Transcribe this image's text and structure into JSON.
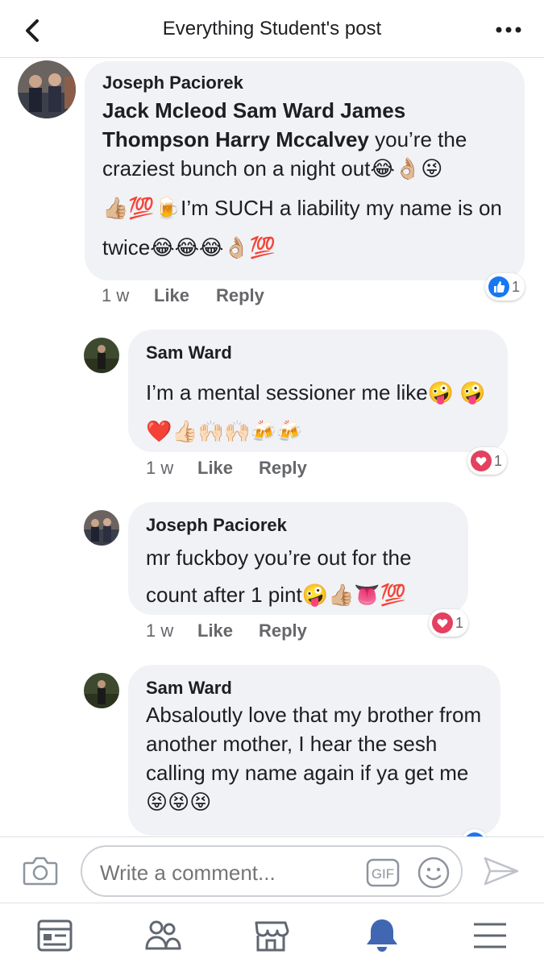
{
  "header": {
    "title": "Everything Student's post",
    "back_icon": "chevron-left-icon",
    "more_icon": "more-horizontal-icon"
  },
  "comments": [
    {
      "author": "Joseph Paciorek",
      "tags": "Jack Mcleod Sam Ward James Thompson Harry Mccalvey",
      "text1": " you’re the craziest bunch on a night out😂👌🏼😜",
      "text2": "👍🏼💯🍺I’m SUCH a liability my name is on twice😂😂😂👌🏼💯",
      "time": "1 w",
      "like": "Like",
      "reply": "Reply",
      "reaction_type": "like",
      "reaction_count": "1"
    },
    {
      "author": "Sam Ward",
      "text": "I’m a mental sessioner me like🤪 🤪❤️👍🏻🙌🏻🙌🏻🍻🍻",
      "time": "1 w",
      "like": "Like",
      "reply": "Reply",
      "reaction_type": "love",
      "reaction_count": "1"
    },
    {
      "author": "Joseph Paciorek",
      "text": "mr fuckboy you’re out for the count after 1 pint🤪👍🏼👅💯",
      "time": "1 w",
      "like": "Like",
      "reply": "Reply",
      "reaction_type": "love",
      "reaction_count": "1"
    },
    {
      "author": "Sam Ward",
      "text": "Absaloutly love that my brother from another mother, I hear the sesh calling my name again if ya get me😝😝😝"
    }
  ],
  "composer": {
    "placeholder": "Write a comment...",
    "gif_label": "GIF"
  },
  "tabbar": {
    "items": [
      "news-feed-icon",
      "friends-icon",
      "marketplace-icon",
      "notifications-icon",
      "menu-icon"
    ],
    "active": "notifications-icon"
  },
  "colors": {
    "accent": "#4267b2",
    "like_blue": "#1877f2",
    "love_red": "#e4405f",
    "bubble_bg": "#f0f2f5",
    "meta_gray": "#65676b"
  }
}
